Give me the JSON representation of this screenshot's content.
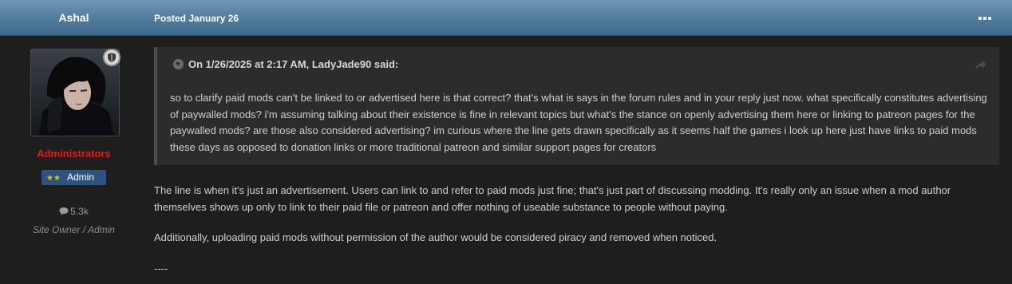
{
  "post": {
    "author": "Ashal",
    "posted": "Posted January 26",
    "group": "Administrators",
    "rank": {
      "stars": "★★",
      "label": "Admin"
    },
    "post_count": "5.3k",
    "user_title": "Site Owner / Admin"
  },
  "quote": {
    "header": "On 1/26/2025 at 2:17 AM, LadyJade90 said:",
    "text": "so to clarify paid mods can't be linked to or advertised here is that correct? that's what is says in the forum rules and in your reply just now. what specifically constitutes advertising of paywalled mods? i'm assuming talking about their existence is fine in relevant topics but what's the stance on openly advertising them here or linking to patreon pages for the paywalled mods? are those also considered advertising? im curious where the line gets drawn specifically as it seems half the games i look up here just have links to paid mods these days as opposed to donation links or more traditional patreon and similar support pages for creators"
  },
  "content": {
    "p1": "The line is when it's just an advertisement. Users can link to and refer to paid mods just fine; that's just part of discussing modding. It's really only an issue when a mod author themselves shows up only to link to their paid file or patreon and offer nothing of useable substance to people without paying.",
    "p2": "Additionally, uploading paid mods without permission of the author would be considered piracy and removed when noticed.",
    "p3": "----"
  },
  "colors": {
    "header_gradient_top": "#6f96b5",
    "header_gradient_bottom": "#3f6988",
    "group_name": "#e51b1b",
    "rank_badge": "#2b5480",
    "rank_stars": "#f2c200"
  }
}
